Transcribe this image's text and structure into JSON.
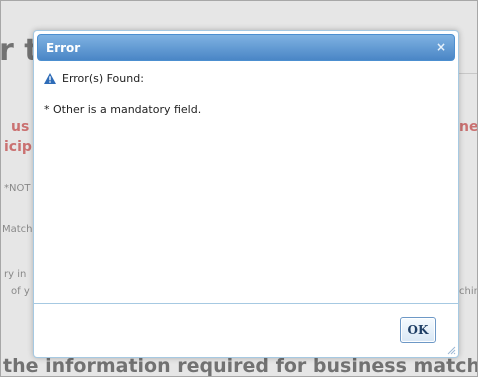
{
  "background": {
    "heading_fragment": "r t",
    "red_fragment_1": "us",
    "red_fragment_2": "icip",
    "red_fragment_right": "nes",
    "note_fragment": "*NOT",
    "match_fragment": "Match",
    "info_fragment_1": "ry in",
    "info_fragment_2": "of y",
    "right_fragment": "chin",
    "bottom_heading": "the information required for business match"
  },
  "dialog": {
    "title": "Error",
    "close_symbol": "×",
    "error_heading": "Error(s) Found:",
    "message": "* Other is a mandatory field.",
    "ok_label": "OK"
  },
  "colors": {
    "titlebar_top": "#7fb2e2",
    "titlebar_bottom": "#4a86c6",
    "dialog_border": "#a6c9e2",
    "warning_icon": "#2e6cb8",
    "background_red_text": "#cc2a2a"
  },
  "icons": {
    "close": "close-icon",
    "warning": "warning-icon",
    "resize": "resize-grip-icon"
  }
}
